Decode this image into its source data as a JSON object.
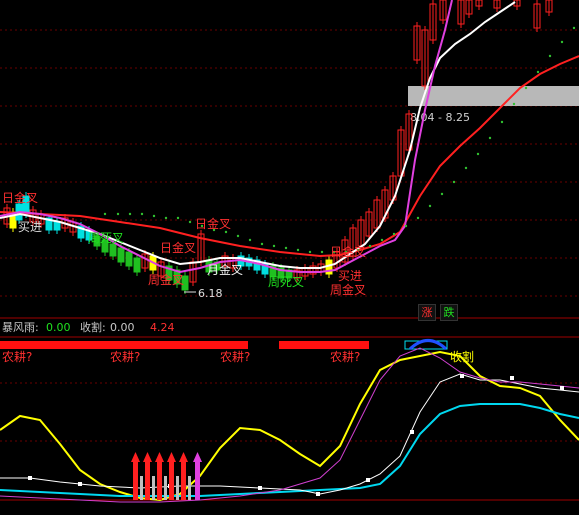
{
  "main_chart": {
    "price_zone_label": "8.04 - 8.25",
    "low_marker": "6.18",
    "signals": {
      "ri_jin_cha_1": "日金叉",
      "ri_jin_cha_2": "日金叉",
      "ri_jin_cha_3": "日金叉",
      "ri_jin_cha_4": "日金叉",
      "ri_jin_cha_5": "日金叉",
      "yue_jin_cha": "月金叉",
      "zhou_jin_cha_1": "周金叉",
      "zhou_jin_cha_2": "周金叉",
      "zhou_si_cha": "周死叉",
      "zhou_si_cha_2": "周死叉",
      "mai_jin_1": "买进",
      "mai_jin_2": "买进",
      "zhou_jin_cha_3": "周金叉"
    }
  },
  "indicator": {
    "name": "暴风雨",
    "name_value": "0.00",
    "shouge_label": "收割",
    "shouge_value": "0.00",
    "extra_value": "4.24",
    "nonggeng_label": "农耕?",
    "shouge_signal": "收割"
  },
  "buttons": {
    "up_label": "涨",
    "down_label": "跌"
  },
  "colors": {
    "background": "#000000",
    "grid": "#5a0000",
    "up_candle": "#ff2020",
    "down_candle": "#00e0e0",
    "ma_white": "#ffffff",
    "ma_magenta": "#e030e0",
    "ma_red": "#ff2020",
    "yellow_line": "#ffff00",
    "cyan_line": "#00e0f0",
    "signal_red": "#ff2020"
  }
}
